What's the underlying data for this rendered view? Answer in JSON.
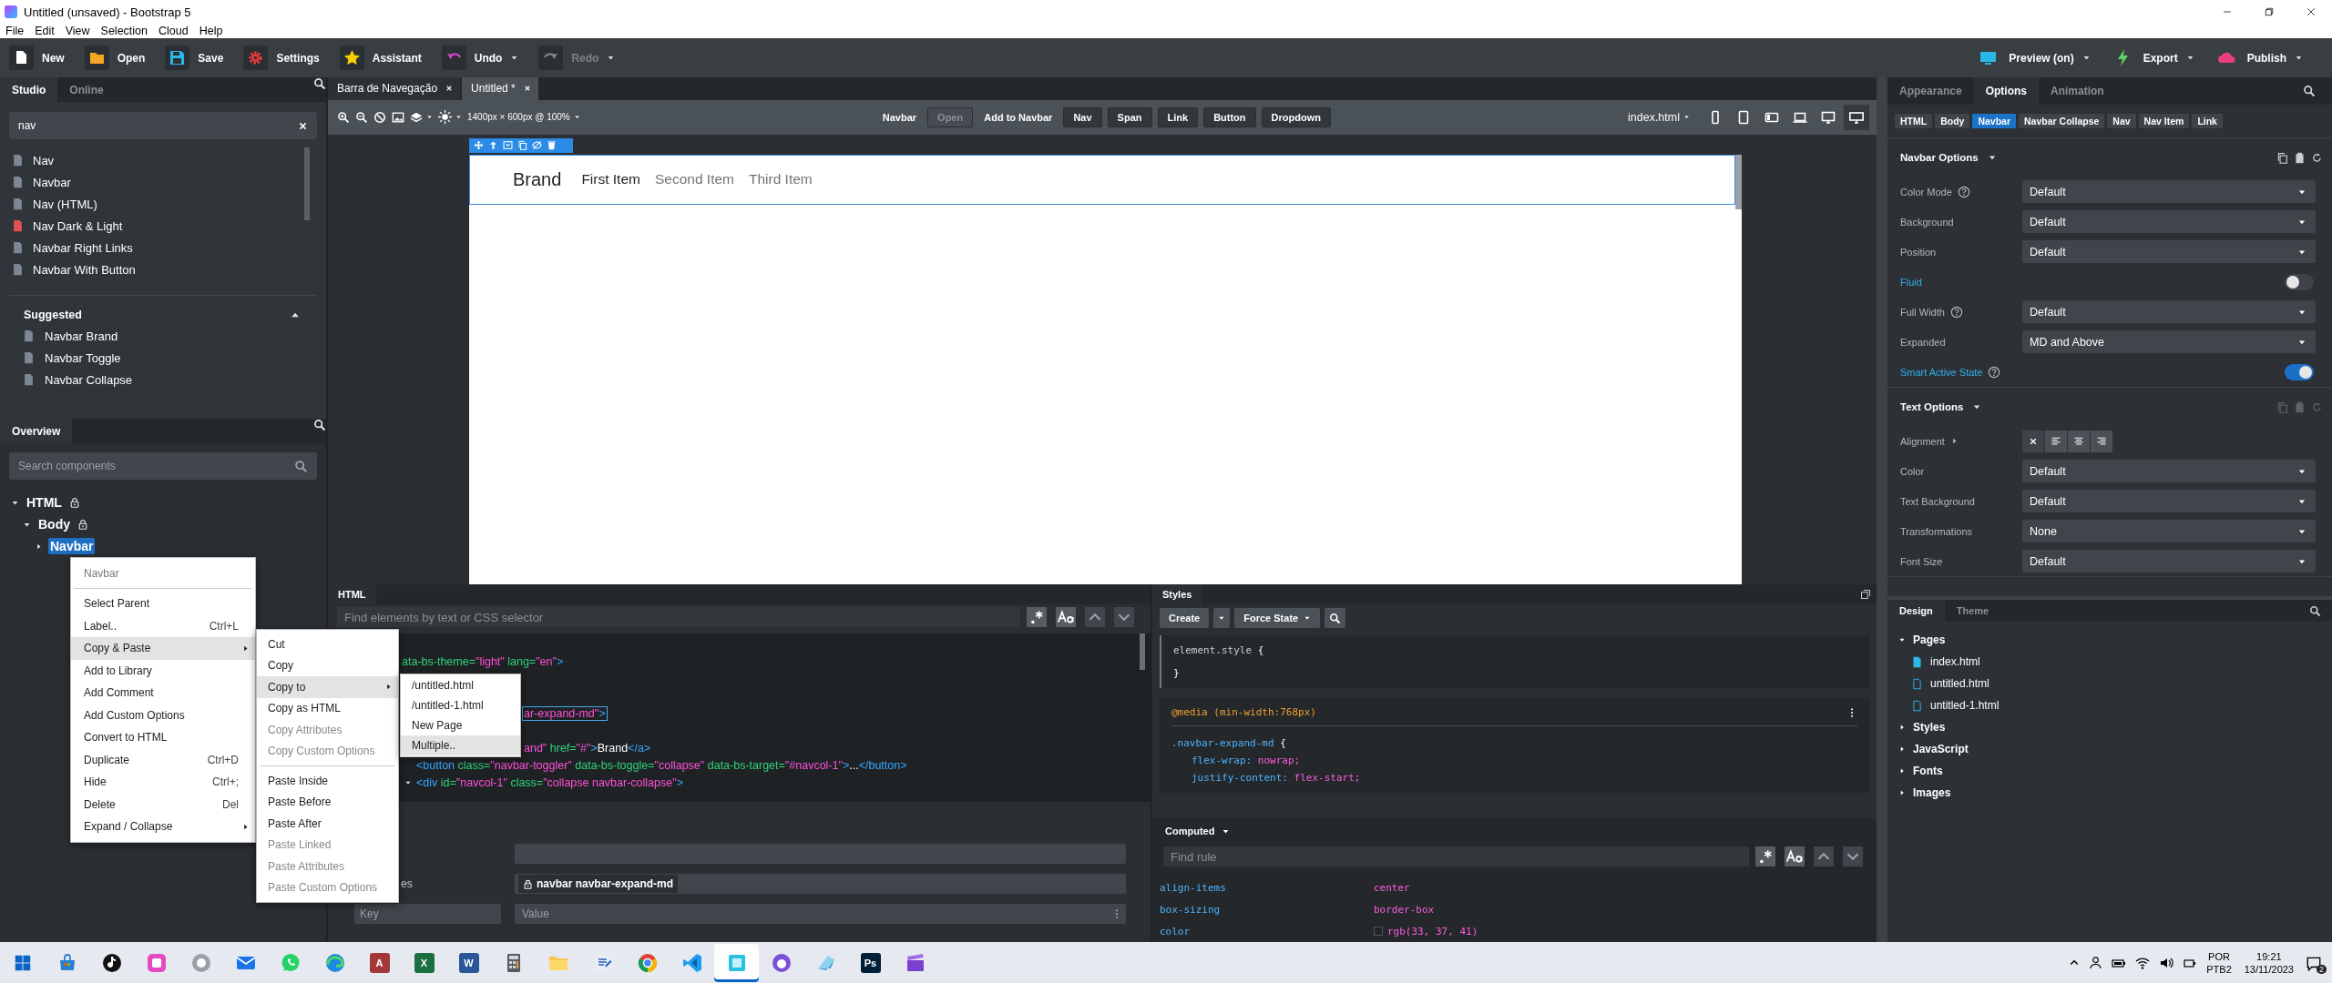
{
  "title_bar": {
    "title": "Untitled (unsaved) - Bootstrap 5"
  },
  "menu_bar": [
    "File",
    "Edit",
    "View",
    "Selection",
    "Cloud",
    "Help"
  ],
  "toolbar": {
    "left": [
      {
        "kind": "new",
        "label": "New",
        "disabled": false,
        "dropdown": false
      },
      {
        "kind": "open",
        "label": "Open",
        "disabled": false,
        "dropdown": false
      },
      {
        "kind": "save",
        "label": "Save",
        "disabled": false,
        "dropdown": false
      },
      {
        "kind": "settings",
        "label": "Settings",
        "disabled": false,
        "dropdown": false
      },
      {
        "kind": "assistant",
        "label": "Assistant",
        "disabled": false,
        "dropdown": false
      },
      {
        "kind": "undo",
        "label": "Undo",
        "disabled": false,
        "dropdown": true
      },
      {
        "kind": "redo",
        "label": "Redo",
        "disabled": true,
        "dropdown": true
      }
    ],
    "right": [
      {
        "kind": "preview",
        "label": "Preview (on)"
      },
      {
        "kind": "export",
        "label": "Export"
      },
      {
        "kind": "publish",
        "label": "Publish"
      }
    ]
  },
  "studio": {
    "tabs": [
      {
        "label": "Studio",
        "selected": true
      },
      {
        "label": "Online",
        "selected": false
      }
    ],
    "search": {
      "value": "nav"
    },
    "results": [
      {
        "label": "Nav",
        "color": "#7d8894"
      },
      {
        "label": "Navbar",
        "color": "#7d8894"
      },
      {
        "label": "Nav (HTML)",
        "color": "#7d8894"
      },
      {
        "label": "Nav Dark & Light",
        "color": "#e05252"
      },
      {
        "label": "Navbar Right Links",
        "color": "#7d8894"
      },
      {
        "label": "Navbar With Button",
        "color": "#7d8894"
      }
    ],
    "suggested": {
      "title": "Suggested",
      "expanded": true,
      "items": [
        "Navbar Brand",
        "Navbar Toggle",
        "Navbar Collapse"
      ]
    }
  },
  "overview": {
    "tab": "Overview",
    "search": {
      "placeholder": "Search components"
    },
    "tree": [
      {
        "label": "HTML",
        "locked": true,
        "expanded": true,
        "selected": false,
        "children": [
          {
            "label": "Body",
            "locked": true,
            "expanded": true,
            "selected": false,
            "children": [
              {
                "label": "Navbar",
                "locked": false,
                "expanded": false,
                "selected": true
              }
            ]
          }
        ]
      }
    ]
  },
  "context_menu": {
    "header": "Navbar",
    "items": [
      {
        "label": "Select Parent",
        "highlighted": false,
        "submenu": false
      },
      {
        "label": "Label..",
        "shortcut": "Ctrl+L",
        "highlighted": false,
        "submenu": false
      },
      {
        "label": "Copy & Paste",
        "highlighted": true,
        "submenu": true
      },
      {
        "label": "Add to Library",
        "highlighted": false,
        "submenu": false
      },
      {
        "label": "Add Comment",
        "highlighted": false,
        "submenu": false
      },
      {
        "label": "Add Custom Options",
        "highlighted": false,
        "submenu": false
      },
      {
        "label": "Convert to HTML",
        "highlighted": false,
        "submenu": false
      },
      {
        "label": "Duplicate",
        "shortcut": "Ctrl+D",
        "highlighted": false,
        "submenu": false
      },
      {
        "label": "Hide",
        "shortcut": "Ctrl+;",
        "highlighted": false,
        "submenu": false
      },
      {
        "label": "Delete",
        "shortcut": "Del",
        "highlighted": false,
        "submenu": false
      },
      {
        "label": "Expand / Collapse",
        "highlighted": false,
        "submenu": true
      }
    ]
  },
  "copy_paste_menu": {
    "groups": [
      [
        {
          "label": "Cut",
          "disabled": false,
          "highlighted": false,
          "submenu": false
        },
        {
          "label": "Copy",
          "disabled": false,
          "highlighted": false,
          "submenu": false
        },
        {
          "label": "Copy to",
          "disabled": false,
          "highlighted": true,
          "submenu": true
        },
        {
          "label": "Copy as HTML",
          "disabled": false,
          "highlighted": false,
          "submenu": false
        },
        {
          "label": "Copy Attributes",
          "disabled": true,
          "highlighted": false,
          "submenu": false
        },
        {
          "label": "Copy Custom Options",
          "disabled": true,
          "highlighted": false,
          "submenu": false
        }
      ],
      [
        {
          "label": "Paste Inside",
          "disabled": false,
          "highlighted": false,
          "submenu": false
        },
        {
          "label": "Paste Before",
          "disabled": false,
          "highlighted": false,
          "submenu": false
        },
        {
          "label": "Paste After",
          "disabled": false,
          "highlighted": false,
          "submenu": false
        },
        {
          "label": "Paste Linked",
          "disabled": true,
          "highlighted": false,
          "submenu": false
        },
        {
          "label": "Paste Attributes",
          "disabled": true,
          "highlighted": false,
          "submenu": false
        },
        {
          "label": "Paste Custom Options",
          "disabled": true,
          "highlighted": false,
          "submenu": false
        }
      ]
    ]
  },
  "copy_to_menu": {
    "items": [
      {
        "label": "/untitled.html",
        "highlighted": false
      },
      {
        "label": "/untitled-1.html",
        "highlighted": false
      },
      {
        "label": "New Page",
        "highlighted": false
      },
      {
        "label": "Multiple..",
        "highlighted": true
      }
    ]
  },
  "editor_tabs": [
    {
      "label": "Barra de Navegação",
      "selected": false
    },
    {
      "label": "Untitled *",
      "selected": true
    }
  ],
  "canvas_toolbar": {
    "size": "1400px × 600px @ 100%",
    "component": "Navbar",
    "open_button": {
      "label": "Open",
      "disabled": true
    },
    "add_label": "Add to Navbar",
    "add_buttons": [
      "Nav",
      "Span",
      "Link",
      "Button",
      "Dropdown"
    ],
    "page": "index.html",
    "devices": [
      {
        "kind": "phone",
        "selected": false
      },
      {
        "kind": "tablet",
        "selected": false
      },
      {
        "kind": "tablet-wide",
        "selected": false
      },
      {
        "kind": "laptop",
        "selected": false
      },
      {
        "kind": "desktop",
        "selected": false
      },
      {
        "kind": "wide",
        "selected": true
      }
    ]
  },
  "canvas": {
    "navbar": {
      "brand": "Brand",
      "items": [
        {
          "label": "First Item",
          "selected": true
        },
        {
          "label": "Second Item",
          "selected": false
        },
        {
          "label": "Third Item",
          "selected": false
        }
      ]
    }
  },
  "html_panel": {
    "tab": "HTML",
    "find": {
      "placeholder": "Find elements by text or CSS selector"
    },
    "code_lines": [
      {
        "selected": false,
        "expandable": false,
        "segments": [
          {
            "kind": "attr",
            "text": "ata-bs-theme="
          },
          {
            "kind": "str",
            "text": "\"light\""
          },
          {
            "kind": "attr",
            "text": " lang="
          },
          {
            "kind": "str",
            "text": "\"en\""
          },
          {
            "kind": "tag",
            "text": ">"
          }
        ]
      },
      {
        "selected": true,
        "expandable": false,
        "segments": [
          {
            "kind": "str",
            "text": "ar-expand-md\""
          },
          {
            "kind": "tag",
            "text": ">"
          }
        ]
      },
      {
        "selected": false,
        "expandable": false,
        "segments": [
          {
            "kind": "str",
            "text": "and\""
          },
          {
            "kind": "attr",
            "text": " href="
          },
          {
            "kind": "str",
            "text": "\"#\""
          },
          {
            "kind": "tag",
            "text": ">"
          },
          {
            "kind": "text",
            "text": "Brand"
          },
          {
            "kind": "tag",
            "text": "</a>"
          }
        ]
      },
      {
        "selected": false,
        "expandable": false,
        "segments": [
          {
            "kind": "tag",
            "text": "<button"
          },
          {
            "kind": "attr",
            "text": " class="
          },
          {
            "kind": "str",
            "text": "\"navbar-toggler\""
          },
          {
            "kind": "attr",
            "text": " data-bs-toggle="
          },
          {
            "kind": "str",
            "text": "\"collapse\""
          },
          {
            "kind": "attr",
            "text": " data-bs-target="
          },
          {
            "kind": "str",
            "text": "\"#navcol-1\""
          },
          {
            "kind": "tag",
            "text": ">"
          },
          {
            "kind": "text",
            "text": "..."
          },
          {
            "kind": "tag",
            "text": "</button>"
          }
        ]
      },
      {
        "selected": false,
        "expandable": true,
        "segments": [
          {
            "kind": "tag",
            "text": "<div"
          },
          {
            "kind": "attr",
            "text": " id="
          },
          {
            "kind": "str",
            "text": "\"navcol-1\""
          },
          {
            "kind": "attr",
            "text": " class="
          },
          {
            "kind": "str",
            "text": "\"collapse navbar-collapse\""
          },
          {
            "kind": "tag",
            "text": ">"
          }
        ]
      }
    ],
    "attributes": {
      "label": "es",
      "classes": "navbar navbar-expand-md",
      "key_placeholder": "Key",
      "value_placeholder": "Value"
    }
  },
  "styles_panel": {
    "tab": "Styles",
    "create": "Create",
    "force_state": "Force State",
    "rules": [
      {
        "selector": "element.style",
        "open": "{",
        "close": "}"
      },
      {
        "media": "@media (min-width:768px)",
        "selector": ".navbar-expand-md",
        "open": "{",
        "declarations": [
          {
            "property": "flex-wrap:",
            "value": "nowrap;"
          },
          {
            "property": "justify-content:",
            "value": "flex-start;"
          }
        ]
      }
    ],
    "computed": {
      "title": "Computed",
      "expanded": true,
      "find_placeholder": "Find rule",
      "rows": [
        {
          "property": "align-items",
          "value": "center"
        },
        {
          "property": "box-sizing",
          "value": "border-box"
        },
        {
          "property": "color",
          "value": "rgb(33, 37, 41)",
          "color": "#212529"
        }
      ]
    }
  },
  "options_panel": {
    "tabs": [
      {
        "label": "Appearance",
        "selected": false
      },
      {
        "label": "Options",
        "selected": true
      },
      {
        "label": "Animation",
        "selected": false
      }
    ],
    "breadcrumbs": [
      {
        "label": "HTML",
        "selected": false
      },
      {
        "label": "Body",
        "selected": false
      },
      {
        "label": "Navbar",
        "selected": true
      },
      {
        "label": "Navbar Collapse",
        "selected": false
      },
      {
        "label": "Nav",
        "selected": false
      },
      {
        "label": "Nav Item",
        "selected": false
      },
      {
        "label": "Link",
        "selected": false
      }
    ],
    "sections": [
      {
        "title": "Navbar Options",
        "expanded": true,
        "actions_enabled": true,
        "rows": [
          {
            "kind": "select",
            "label": "Color Mode",
            "help": true,
            "highlighted": false,
            "value": "Default"
          },
          {
            "kind": "select",
            "label": "Background",
            "help": false,
            "highlighted": false,
            "value": "Default"
          },
          {
            "kind": "select",
            "label": "Position",
            "help": false,
            "highlighted": false,
            "value": "Default"
          },
          {
            "kind": "toggle",
            "label": "Fluid",
            "help": false,
            "highlighted": true,
            "on": false
          },
          {
            "kind": "select",
            "label": "Full Width",
            "help": true,
            "highlighted": false,
            "value": "Default"
          },
          {
            "kind": "select",
            "label": "Expanded",
            "help": false,
            "highlighted": false,
            "value": "MD and Above"
          },
          {
            "kind": "toggle",
            "label": "Smart Active State",
            "help": true,
            "highlighted": true,
            "on": true
          }
        ]
      },
      {
        "title": "Text Options",
        "expanded": true,
        "actions_enabled": false,
        "rows": [
          {
            "kind": "align",
            "label": "Alignment",
            "help": false,
            "highlighted": false,
            "expanded": false
          },
          {
            "kind": "select",
            "label": "Color",
            "help": false,
            "highlighted": false,
            "value": "Default"
          },
          {
            "kind": "select",
            "label": "Text Background",
            "help": false,
            "highlighted": false,
            "value": "Default"
          },
          {
            "kind": "select",
            "label": "Transformations",
            "help": false,
            "highlighted": false,
            "value": "None"
          },
          {
            "kind": "select",
            "label": "Font Size",
            "help": false,
            "highlighted": false,
            "value": "Default"
          }
        ]
      }
    ]
  },
  "design_panel": {
    "tabs": [
      {
        "label": "Design",
        "selected": true
      },
      {
        "label": "Theme",
        "selected": false
      }
    ],
    "tree": [
      {
        "label": "Pages",
        "expanded": true,
        "children": [
          {
            "label": "index.html",
            "active": true
          },
          {
            "label": "untitled.html",
            "active": false
          },
          {
            "label": "untitled-1.html",
            "active": false
          }
        ]
      },
      {
        "label": "Styles",
        "expanded": false
      },
      {
        "label": "JavaScript",
        "expanded": false
      },
      {
        "label": "Fonts",
        "expanded": false
      },
      {
        "label": "Images",
        "expanded": false
      }
    ]
  },
  "taskbar": {
    "apps": [
      {
        "kind": "store",
        "active": false
      },
      {
        "kind": "note",
        "active": false
      },
      {
        "kind": "tile",
        "active": false
      },
      {
        "kind": "circle",
        "active": false
      },
      {
        "kind": "mail",
        "active": false
      },
      {
        "kind": "chat",
        "active": false
      },
      {
        "kind": "swirl",
        "active": false
      },
      {
        "kind": "letter",
        "text": "A",
        "color": "#a4373a",
        "active": false
      },
      {
        "kind": "letter",
        "text": "X",
        "color": "#1d6f42",
        "active": false
      },
      {
        "kind": "letter",
        "text": "W",
        "color": "#2b579a",
        "active": false
      },
      {
        "kind": "calculator",
        "active": false
      },
      {
        "kind": "folder",
        "active": false
      },
      {
        "kind": "document",
        "active": false
      },
      {
        "kind": "wheel",
        "active": false
      },
      {
        "kind": "ribbon",
        "active": false
      },
      {
        "kind": "square",
        "active": true
      },
      {
        "kind": "circle2",
        "active": false
      },
      {
        "kind": "wedge",
        "active": false
      },
      {
        "kind": "letter",
        "text": "Ps",
        "color": "#001e36",
        "active": false
      },
      {
        "kind": "clapper",
        "active": false
      }
    ],
    "language": "POR",
    "layout": "PTB2",
    "time": "19:21",
    "date": "13/11/2023",
    "notifications": "2"
  }
}
